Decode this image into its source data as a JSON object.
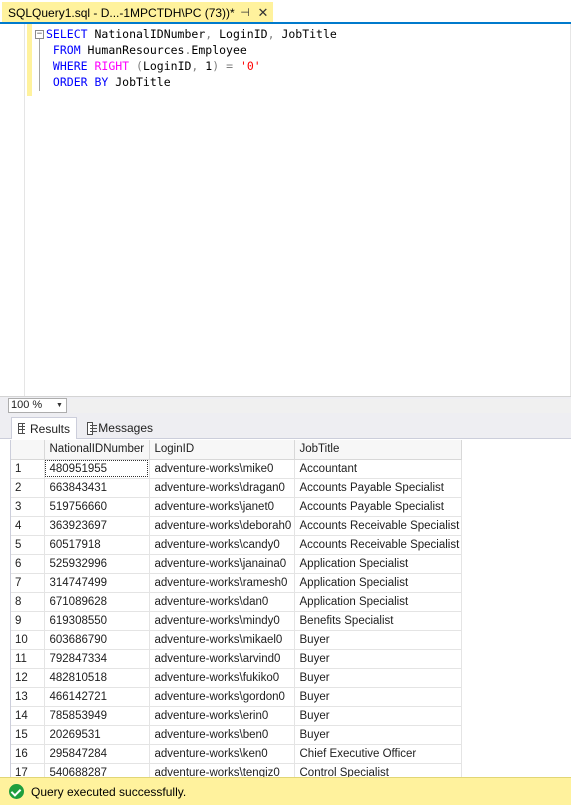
{
  "document_tab": {
    "title": "SQLQuery1.sql - D...-1MPCTDH\\PC (73))*",
    "pin_glyph": "⊣",
    "close_glyph": "✕"
  },
  "editor": {
    "collapse_glyph": "−",
    "lines": [
      [
        {
          "t": "SELECT",
          "c": "kw"
        },
        {
          "t": " NationalIDNumber",
          "c": "id"
        },
        {
          "t": ",",
          "c": "op"
        },
        {
          "t": " LoginID",
          "c": "id"
        },
        {
          "t": ",",
          "c": "op"
        },
        {
          "t": " JobTitle",
          "c": "id"
        }
      ],
      [
        {
          "t": " FROM",
          "c": "kw"
        },
        {
          "t": " HumanResources",
          "c": "id"
        },
        {
          "t": ".",
          "c": "op"
        },
        {
          "t": "Employee",
          "c": "id"
        }
      ],
      [
        {
          "t": " WHERE",
          "c": "kw"
        },
        {
          "t": " RIGHT",
          "c": "fn"
        },
        {
          "t": " (",
          "c": "op"
        },
        {
          "t": "LoginID",
          "c": "id"
        },
        {
          "t": ",",
          "c": "op"
        },
        {
          "t": " 1",
          "c": "id"
        },
        {
          "t": ")",
          "c": "op"
        },
        {
          "t": " =",
          "c": "op"
        },
        {
          "t": " '0'",
          "c": "str"
        }
      ],
      [
        {
          "t": " ORDER BY",
          "c": "kw"
        },
        {
          "t": " JobTitle",
          "c": "id"
        }
      ]
    ]
  },
  "zoom": {
    "value": "100 %",
    "arrow_glyph": "▼"
  },
  "result_tabs": {
    "results_label": "Results",
    "messages_label": "Messages"
  },
  "grid": {
    "columns": [
      "",
      "NationalIDNumber",
      "LoginID",
      "JobTitle"
    ],
    "rows": [
      [
        "1",
        "480951955",
        "adventure-works\\mike0",
        "Accountant"
      ],
      [
        "2",
        "663843431",
        "adventure-works\\dragan0",
        "Accounts Payable Specialist"
      ],
      [
        "3",
        "519756660",
        "adventure-works\\janet0",
        "Accounts Payable Specialist"
      ],
      [
        "4",
        "363923697",
        "adventure-works\\deborah0",
        "Accounts Receivable Specialist"
      ],
      [
        "5",
        "60517918",
        "adventure-works\\candy0",
        "Accounts Receivable Specialist"
      ],
      [
        "6",
        "525932996",
        "adventure-works\\janaina0",
        "Application Specialist"
      ],
      [
        "7",
        "314747499",
        "adventure-works\\ramesh0",
        "Application Specialist"
      ],
      [
        "8",
        "671089628",
        "adventure-works\\dan0",
        "Application Specialist"
      ],
      [
        "9",
        "619308550",
        "adventure-works\\mindy0",
        "Benefits Specialist"
      ],
      [
        "10",
        "603686790",
        "adventure-works\\mikael0",
        "Buyer"
      ],
      [
        "11",
        "792847334",
        "adventure-works\\arvind0",
        "Buyer"
      ],
      [
        "12",
        "482810518",
        "adventure-works\\fukiko0",
        "Buyer"
      ],
      [
        "13",
        "466142721",
        "adventure-works\\gordon0",
        "Buyer"
      ],
      [
        "14",
        "785853949",
        "adventure-works\\erin0",
        "Buyer"
      ],
      [
        "15",
        "20269531",
        "adventure-works\\ben0",
        "Buyer"
      ],
      [
        "16",
        "295847284",
        "adventure-works\\ken0",
        "Chief Executive Officer"
      ],
      [
        "17",
        "540688287",
        "adventure-works\\tengiz0",
        "Control Specialist"
      ]
    ]
  },
  "status": {
    "message": "Query executed successfully."
  },
  "colors": {
    "tab_active": "#fff29d",
    "accent": "#007acc",
    "keyword": "#0000ff",
    "function": "#ff00ff",
    "string": "#ff0000",
    "status_bar": "#fff29d",
    "success": "#1e9e3e"
  }
}
